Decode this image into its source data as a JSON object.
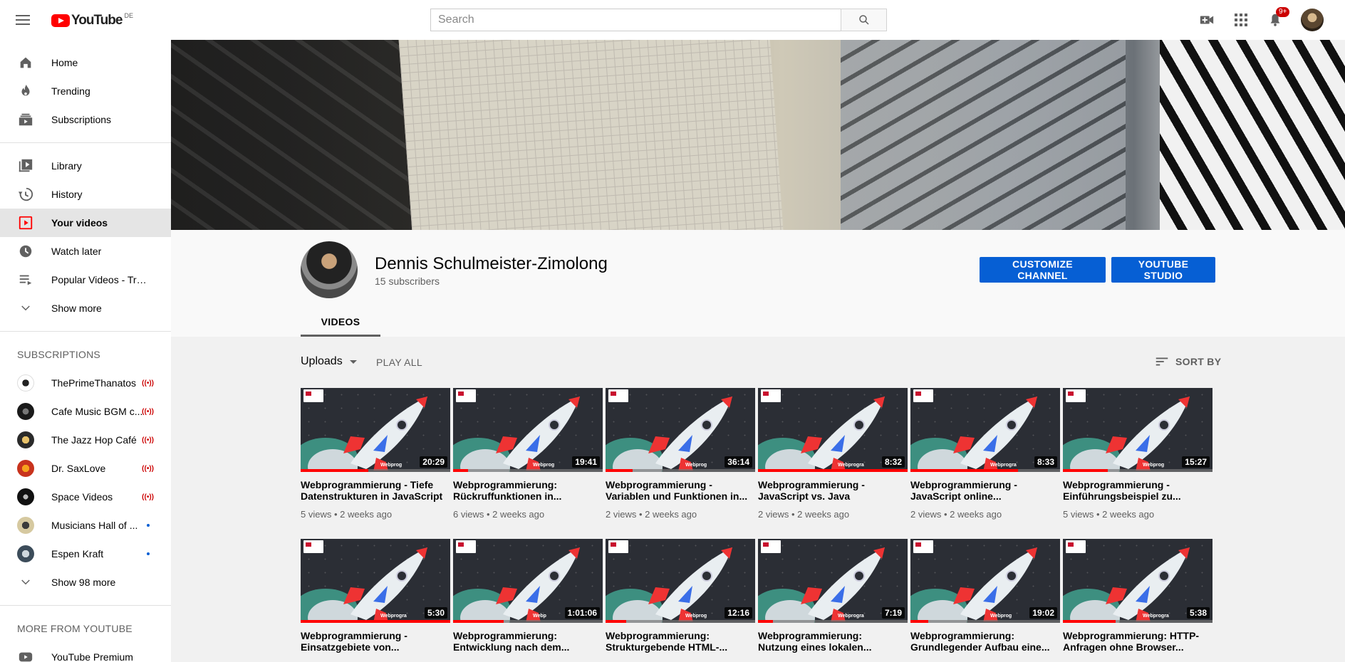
{
  "header": {
    "logo_text": "YouTube",
    "country": "DE",
    "search_placeholder": "Search",
    "notification_count": "9+"
  },
  "sidebar": {
    "main": [
      {
        "label": "Home",
        "icon": "home-icon"
      },
      {
        "label": "Trending",
        "icon": "trending-icon"
      },
      {
        "label": "Subscriptions",
        "icon": "subscriptions-icon"
      }
    ],
    "library": [
      {
        "label": "Library",
        "icon": "library-icon"
      },
      {
        "label": "History",
        "icon": "history-icon"
      },
      {
        "label": "Your videos",
        "icon": "your-videos-icon",
        "active": true
      },
      {
        "label": "Watch later",
        "icon": "watch-later-icon"
      },
      {
        "label": "Popular Videos - Tran...",
        "icon": "playlist-icon"
      },
      {
        "label": "Show more",
        "icon": "chevron-down-icon"
      }
    ],
    "subscriptions_heading": "SUBSCRIPTIONS",
    "subscriptions": [
      {
        "label": "ThePrimeThanatos",
        "status": "live",
        "color": "#ffffff"
      },
      {
        "label": "Cafe Music BGM c...",
        "status": "live",
        "color": "#1a1a1a"
      },
      {
        "label": "The Jazz Hop Café",
        "status": "live",
        "color": "#2a2a2a"
      },
      {
        "label": "Dr. SaxLove",
        "status": "live",
        "color": "#c8331d"
      },
      {
        "label": "Space Videos",
        "status": "live",
        "color": "#111111"
      },
      {
        "label": "Musicians Hall of ...",
        "status": "new",
        "color": "#d6c9a0"
      },
      {
        "label": "Espen Kraft",
        "status": "new",
        "color": "#3c4c5a"
      }
    ],
    "show_more_subs": "Show 98 more",
    "more_heading": "MORE FROM YOUTUBE",
    "more": [
      {
        "label": "YouTube Premium",
        "icon": "youtube-premium-icon"
      }
    ]
  },
  "channel": {
    "name": "Dennis Schulmeister-Zimolong",
    "subscribers": "15 subscribers",
    "customize_label": "CUSTOMIZE CHANNEL",
    "studio_label": "YOUTUBE STUDIO",
    "tab_videos": "VIDEOS"
  },
  "toolbar": {
    "uploads": "Uploads",
    "play_all": "PLAY ALL",
    "sort_by": "SORT BY"
  },
  "videos": [
    {
      "title": "Webprogrammierung - Tiefe Datenstrukturen in JavaScript",
      "duration": "20:29",
      "meta": "5 views • 2 weeks ago",
      "progress": 0.45,
      "overlay": "Webprog"
    },
    {
      "title": "Webprogrammierung: Rückruffunktionen in...",
      "duration": "19:41",
      "meta": "6 views • 2 weeks ago",
      "progress": 0.1,
      "overlay": "Webprog"
    },
    {
      "title": "Webprogrammierung - Variablen und Funktionen in...",
      "duration": "36:14",
      "meta": "2 views • 2 weeks ago",
      "progress": 0.18,
      "overlay": "Webprog"
    },
    {
      "title": "Webprogrammierung - JavaScript vs. Java",
      "duration": "8:32",
      "meta": "2 views • 2 weeks ago",
      "progress": 1.0,
      "overlay": "Webprogra"
    },
    {
      "title": "Webprogrammierung - JavaScript online...",
      "duration": "8:33",
      "meta": "2 views • 2 weeks ago",
      "progress": 0.72,
      "overlay": "Webprogra"
    },
    {
      "title": "Webprogrammierung - Einführungsbeispiel zu...",
      "duration": "15:27",
      "meta": "5 views • 2 weeks ago",
      "progress": 0.3,
      "overlay": "Webprog"
    },
    {
      "title": "Webprogrammierung - Einsatzgebiete von...",
      "duration": "5:30",
      "meta": "",
      "progress": 1.0,
      "overlay": "Webprogra"
    },
    {
      "title": "Webprogrammierung: Entwicklung nach dem...",
      "duration": "1:01:06",
      "meta": "",
      "progress": 0.34,
      "overlay": "Webp"
    },
    {
      "title": "Webprogrammierung: Strukturgebende HTML-...",
      "duration": "12:16",
      "meta": "",
      "progress": 0.14,
      "overlay": "Webprog"
    },
    {
      "title": "Webprogrammierung: Nutzung eines lokalen...",
      "duration": "7:19",
      "meta": "",
      "progress": 0.1,
      "overlay": "Webprogra"
    },
    {
      "title": "Webprogrammierung: Grundlegender Aufbau eine...",
      "duration": "19:02",
      "meta": "",
      "progress": 0.12,
      "overlay": "Webprog"
    },
    {
      "title": "Webprogrammierung: HTTP-Anfragen ohne Browser...",
      "duration": "5:38",
      "meta": "",
      "progress": 0.35,
      "overlay": "Webprogra"
    }
  ],
  "colors": {
    "accent_blue": "#065fd4",
    "brand_red": "#ff0000",
    "live_red": "#cc0000"
  }
}
